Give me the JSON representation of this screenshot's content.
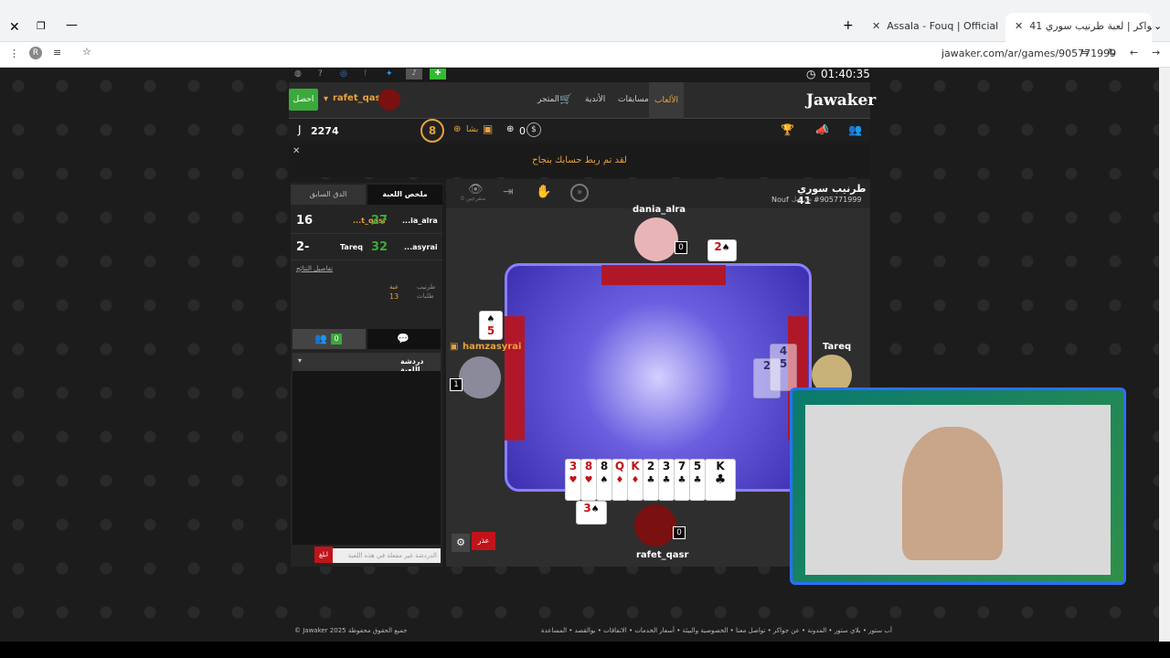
{
  "browser": {
    "tabs": [
      {
        "label": "جواكر | لعبة طرنيب سوري 41",
        "active": true
      },
      {
        "label": "Assala - Fouq | Official Mus",
        "active": false
      }
    ],
    "url": "jawaker.com/ar/games/905771999"
  },
  "header": {
    "clock": "01:40:35",
    "logo": "Jawaker",
    "nav": [
      "الألعاب",
      "مسابقات",
      "الأندية",
      "المتجر"
    ],
    "username": "rafet_qasr",
    "get_button": "احصل"
  },
  "subheader": {
    "coins": "2274",
    "level": "8",
    "vip": "بشا",
    "tokens": "0"
  },
  "notice": "لقد تم ربط حسابك بنجاح",
  "game": {
    "title": "طرنيب سوري 41",
    "id": "#905771999",
    "by_label": "من قبل",
    "owner": "Nouf",
    "spectators": "0 متفرجين"
  },
  "sidebar": {
    "tab_summary": "ملخص اللعبة",
    "tab_prev": "الدق السابق",
    "scores": [
      {
        "left_name": "...ia_alra",
        "left_score": "27",
        "right_name": "...t_qasr",
        "right_score": "16"
      },
      {
        "left_name": "...asyrai",
        "left_score": "32",
        "right_name": "Tareq",
        "right_score": "2-"
      }
    ],
    "details_link": "تفاصيل النتائج",
    "trump_label": "طرنيب",
    "trump_value": "عبة",
    "bids_label": "طلبات",
    "bids_value": "13",
    "chat_count": "0",
    "chat_section": "دردشة اللعبة",
    "chat_placeholder": "الدردشة غير مفعلة في هذه اللعبة",
    "send_button": "ابلغ"
  },
  "players": {
    "top": {
      "name": "dania_alra",
      "score": "0",
      "card": "2"
    },
    "left": {
      "name": "hamzasyrai",
      "score": "1",
      "card": "5"
    },
    "right": {
      "name": "Tareq",
      "score": "2"
    },
    "bottom": {
      "name": "rafet_qasr",
      "score": "0",
      "card": "3"
    }
  },
  "hand": [
    "3",
    "8",
    "8",
    "Q",
    "K",
    "2",
    "3",
    "7",
    "5",
    "K"
  ],
  "right_stack": [
    "4",
    "2",
    "5"
  ],
  "buttons": {
    "forfeit": "عذر"
  },
  "footer": {
    "copyright": "© Jawaker 2025 جميع الحقوق محفوظة",
    "links": "أب ستور  •  بلاي ستور  •  المدونة  •  عن جواكر  •  تواصل معنا  •  الخصوصية والبيئة  •  أسعار الخدمات  •  الاتفاقات  •  بوالقصد  •  المساعدة"
  }
}
